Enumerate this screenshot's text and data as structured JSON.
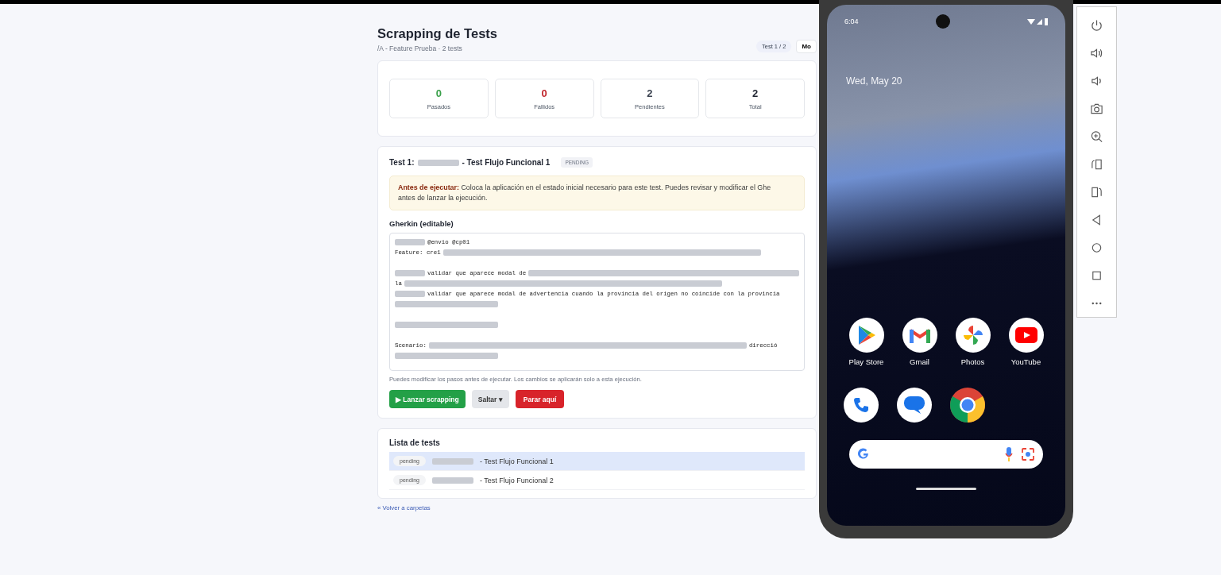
{
  "header": {
    "title": "Scrapping de Tests",
    "subtitle": "/A - Feature Prueba · 2 tests",
    "counter": "Test 1 / 2",
    "button": "Mo"
  },
  "stats": [
    {
      "value": "0",
      "label": "Pasados",
      "color": "#3aa04a"
    },
    {
      "value": "0",
      "label": "Fallidos",
      "color": "#c0262d"
    },
    {
      "value": "2",
      "label": "Pendientes",
      "color": "#3b4250"
    },
    {
      "value": "2",
      "label": "Total",
      "color": "#1f2430"
    }
  ],
  "test": {
    "prefix": "Test 1:",
    "name": "- Test Flujo Funcional 1",
    "status": "PENDING",
    "notice": "**Antes de ejecutar:** Coloca la aplicación en el estado inicial necesario para este test. Puedes revisar y modificar el Ghe\nantes de lanzar la ejecución.",
    "editor_label": "Gherkin (editable)",
    "lines": [
      {
        "kind": "code",
        "segments": [
          {
            "kind": "redacted"
          },
          {
            "kind": "text",
            "text": "@envio @cp01"
          }
        ]
      },
      {
        "kind": "code",
        "segments": [
          {
            "kind": "text",
            "text": "Feature: cre1"
          },
          {
            "kind": "redacted"
          }
        ]
      },
      {
        "kind": "blank"
      },
      {
        "kind": "code",
        "segments": [
          {
            "kind": "redacted"
          },
          {
            "kind": "text",
            "text": "validar que aparece modal de"
          },
          {
            "kind": "redacted"
          }
        ]
      },
      {
        "kind": "code",
        "segments": [
          {
            "kind": "text",
            "text": "la"
          },
          {
            "kind": "redacted"
          }
        ]
      },
      {
        "kind": "code",
        "segments": [
          {
            "kind": "redacted"
          },
          {
            "kind": "text",
            "text": "validar que aparece modal de advertencia cuando la provincia del origen no coincide con la provincia"
          }
        ]
      },
      {
        "kind": "code",
        "segments": [
          {
            "kind": "redacted"
          }
        ]
      },
      {
        "kind": "blank"
      },
      {
        "kind": "code",
        "segments": [
          {
            "kind": "redacted"
          }
        ]
      },
      {
        "kind": "blank"
      },
      {
        "kind": "code",
        "segments": [
          {
            "kind": "text",
            "text": "Scenario:"
          },
          {
            "kind": "redacted"
          },
          {
            "kind": "text",
            "text": "direcció"
          }
        ]
      },
      {
        "kind": "code",
        "segments": [
          {
            "kind": "redacted"
          }
        ]
      }
    ],
    "hint": "Puedes modificar los pasos antes de ejecutar. Los cambios se aplicarán solo a esta ejecución.",
    "buttons": [
      {
        "kind": "primary",
        "label": "▶ Lanzar scrapping"
      },
      {
        "kind": "dropdown",
        "label": "Saltar ▾"
      },
      {
        "kind": "danger",
        "label": "Parar aquí"
      }
    ]
  },
  "test_list": {
    "title": "Lista de tests",
    "items": [
      {
        "status": "pending",
        "name": "- Test Flujo Funcional 1",
        "selected": true
      },
      {
        "status": "pending",
        "name": "- Test Flujo Funcional 2",
        "selected": false
      }
    ]
  },
  "back_link": "« Volver a carpetas",
  "phone": {
    "time": "6:04",
    "date": "Wed, May 20",
    "apps": [
      {
        "label": "Play Store",
        "kind": "play"
      },
      {
        "label": "Gmail",
        "kind": "gmail"
      },
      {
        "label": "Photos",
        "kind": "photos"
      },
      {
        "label": "YouTube",
        "kind": "youtube"
      }
    ],
    "dock": [
      {
        "kind": "phone"
      },
      {
        "kind": "messages"
      },
      {
        "kind": "chrome"
      }
    ]
  }
}
